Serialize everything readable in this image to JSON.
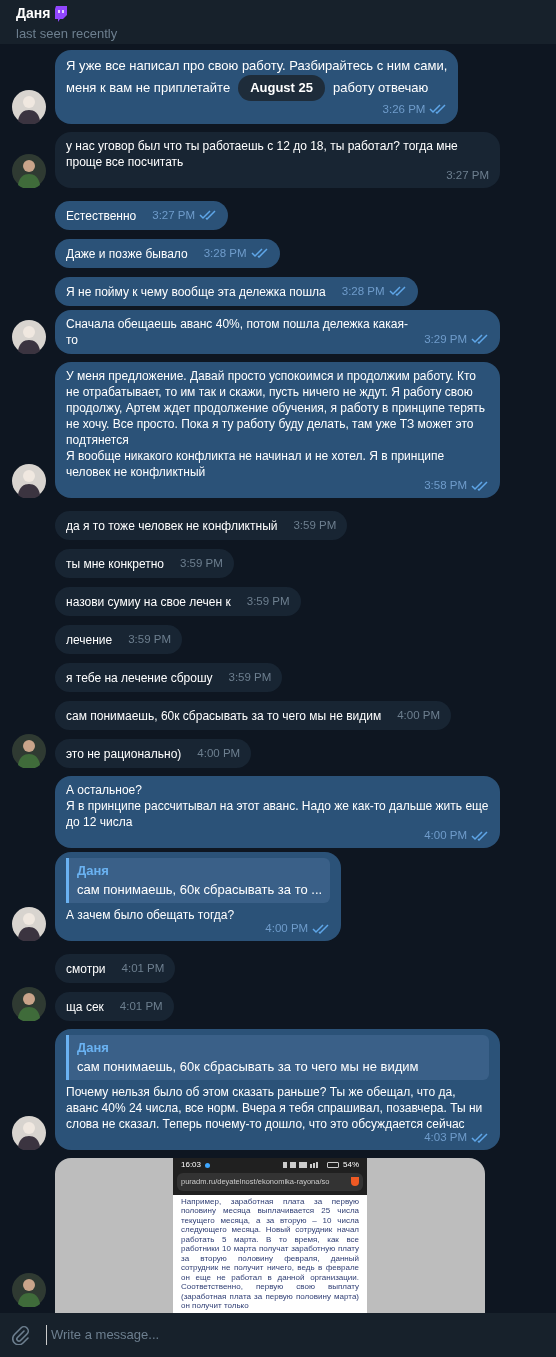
{
  "header": {
    "name": "Даня",
    "status": "last seen recently"
  },
  "date_badge": "August 25",
  "messages": [
    {
      "kind": "outgoing",
      "segments": [
        "Я уже все написал про свою работу. Разбирайтесь с ним сами,",
        "меня к вам не приплетайте",
        "работу отвечаю"
      ],
      "time": "3:26 PM",
      "read": true,
      "avatar": true
    },
    {
      "kind": "incoming",
      "text": "у нас уговор был что ты работаешь с 12 до 18, ты работал? тогда мне проще все посчитать",
      "time": "3:27 PM",
      "avatar": true
    },
    {
      "kind": "outgoing",
      "text": "Естественно",
      "time": "3:27 PM",
      "read": true,
      "avatar": false
    },
    {
      "kind": "outgoing",
      "text": "Даже и позже бывало",
      "time": "3:28 PM",
      "read": true,
      "avatar": false
    },
    {
      "kind": "outgoing",
      "text": "Я не пойму к чему вообще эта дележка пошла",
      "time": "3:28 PM",
      "read": true,
      "avatar": false
    },
    {
      "kind": "outgoing",
      "text": "Сначала обещаешь аванс 40%, потом пошла дележка какая-то",
      "time": "3:29 PM",
      "read": true,
      "avatar": true
    },
    {
      "kind": "outgoing",
      "text": "У меня предложение. Давай просто успокоимся и продолжим работу. Кто не отрабатывает, то им так и скажи, пусть ничего не ждут. Я работу свою продолжу, Артем ждет продолжение обучения, я работу в принципе терять не хочу. Все просто. Пока я ту работу буду делать, там уже ТЗ может это подтянется\nЯ вообще никакого конфликта не начинал и не хотел. Я в принципе человек не конфликтный",
      "time": "3:58 PM",
      "read": true,
      "avatar": true
    },
    {
      "kind": "incoming",
      "text": "да я то тоже человек не конфликтный",
      "time": "3:59 PM",
      "avatar": false
    },
    {
      "kind": "incoming",
      "text": "ты мне конкретно",
      "time": "3:59 PM",
      "avatar": false
    },
    {
      "kind": "incoming",
      "text": "назови сумиу на свое лечен к",
      "time": "3:59 PM",
      "avatar": false
    },
    {
      "kind": "incoming",
      "text": "лечение",
      "time": "3:59 PM",
      "avatar": false
    },
    {
      "kind": "incoming",
      "text": "я тебе на лечение сброшу",
      "time": "3:59 PM",
      "avatar": false
    },
    {
      "kind": "incoming",
      "text": "сам понимаешь, 60к сбрасывать за то чего мы не видим",
      "time": "4:00 PM",
      "avatar": false
    },
    {
      "kind": "incoming",
      "text": "это не рационально)",
      "time": "4:00 PM",
      "avatar": true
    },
    {
      "kind": "outgoing",
      "text": "А остальное?\nЯ в принципе рассчитывал на этот аванс. Надо же как-то дальше жить еще до 12 числа",
      "time": "4:00 PM",
      "read": true,
      "avatar": false
    },
    {
      "kind": "outgoing",
      "reply": {
        "name": "Даня",
        "text": "сам понимаешь, 60к сбрасывать за то ..."
      },
      "text": "А зачем было обещать тогда?",
      "time": "4:00 PM",
      "read": true,
      "avatar": true
    },
    {
      "kind": "incoming",
      "text": "смотри",
      "time": "4:01 PM",
      "avatar": false
    },
    {
      "kind": "incoming",
      "text": "ща сек",
      "time": "4:01 PM",
      "avatar": true
    },
    {
      "kind": "outgoing",
      "reply": {
        "name": "Даня",
        "text": "сам понимаешь, 60к сбрасывать за то чего мы не видим"
      },
      "text": "Почему нельзя было об этом сказать раньше? Ты же обещал, что да, аванс 40% 24 числа, все норм. Вчера я тебя спрашивал, позавчера. Ты ни слова не сказал. Теперь почему-то дошло, что это обсуждается сейчас",
      "time": "4:03 PM",
      "read": true,
      "avatar": true
    },
    {
      "kind": "screenshot",
      "screenshot": {
        "clock": "16:03",
        "battery": "54%",
        "url": "puradm.ru/deyatelnost/ekonomika-rayona/so",
        "paragraph": "Например, заработная плата за первую половину месяца выплачивается 25 числа текущего месяца, а за вторую – 10 числа следующего месяца. Новый сотрудник начал работать 5 марта. В то время, как все работники 10 марта получат заработную плату за вторую половину февраля, данный сотрудник не получит ничего, ведь в феврале он еще не работал в данной организации. Соответственно, первую свою выплату (заработная плата за первую половину марта) он получит только"
      },
      "avatar": true
    }
  ],
  "composer": {
    "placeholder": "Write a message..."
  }
}
